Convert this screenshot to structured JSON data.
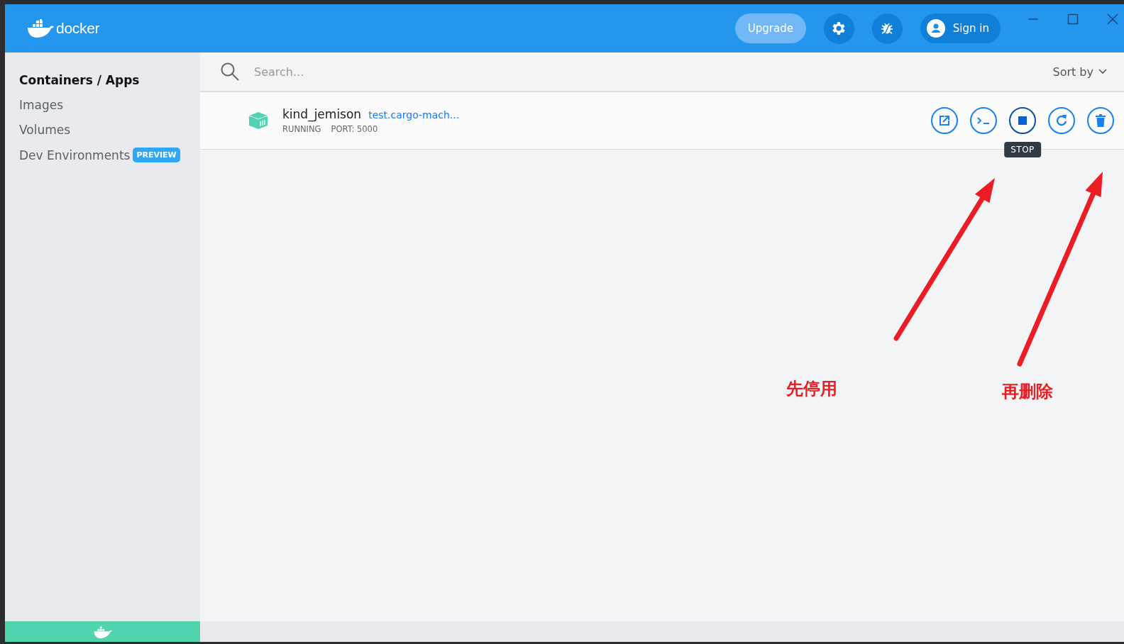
{
  "header": {
    "logo": "docker",
    "upgrade_button": "Upgrade",
    "sign_in_button": "Sign in"
  },
  "sidebar": {
    "items": [
      {
        "label": "Containers / Apps",
        "selected": true
      },
      {
        "label": "Images",
        "selected": false
      },
      {
        "label": "Volumes",
        "selected": false
      },
      {
        "label": "Dev Environments",
        "selected": false,
        "badge": "PREVIEW"
      }
    ]
  },
  "search": {
    "placeholder": "Search..."
  },
  "sort": {
    "label": "Sort by"
  },
  "containers": [
    {
      "name": "kind_jemison",
      "image": "test.cargo-mach...",
      "status": "RUNNING",
      "port": "PORT: 5000",
      "actions": [
        {
          "kind": "open",
          "hovered": false
        },
        {
          "kind": "cli",
          "hovered": false
        },
        {
          "kind": "stop",
          "hovered": true,
          "tooltip": "STOP"
        },
        {
          "kind": "restart",
          "hovered": false
        },
        {
          "kind": "delete",
          "hovered": false
        }
      ]
    }
  ],
  "annotations": [
    {
      "text": "先停用"
    },
    {
      "text": "再删除"
    }
  ]
}
